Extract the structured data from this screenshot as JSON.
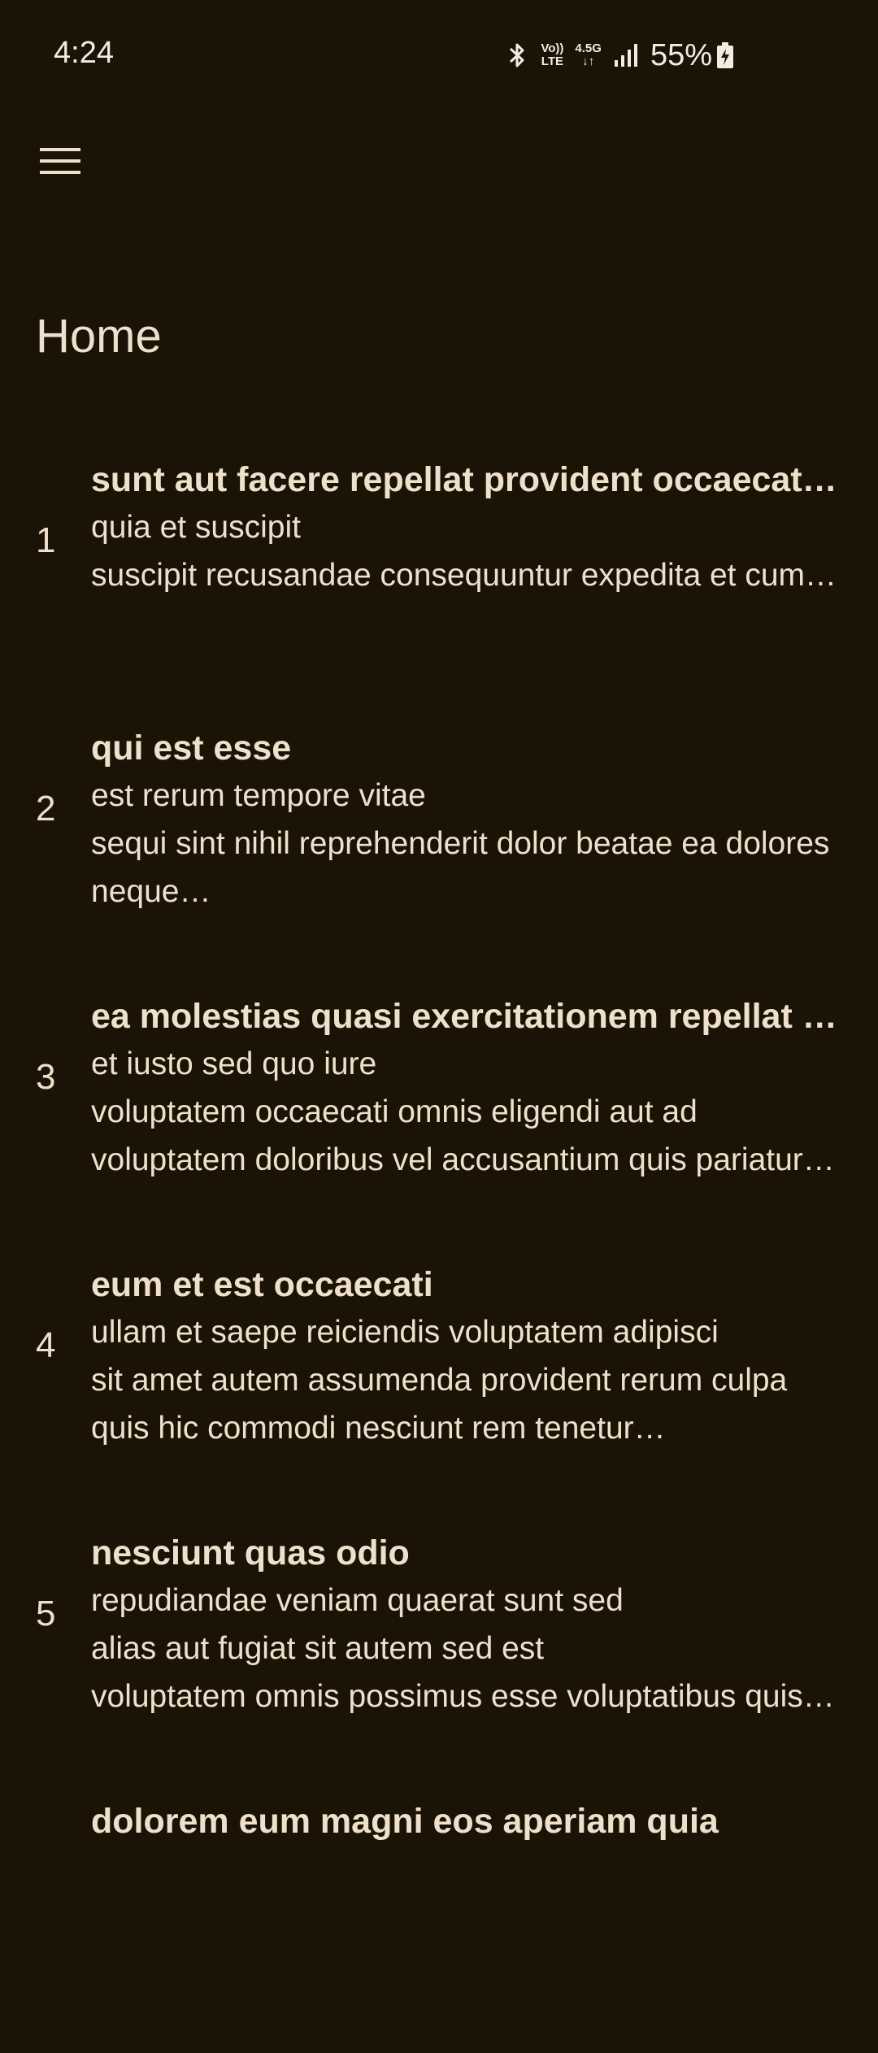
{
  "status_bar": {
    "time": "4:24",
    "volte_top": "Vo))",
    "volte_bottom": "LTE",
    "network_type": "4.5G",
    "battery_percent": "55%",
    "icons": [
      "bluetooth-icon",
      "volte-icon",
      "data-arrows-icon",
      "signal-icon",
      "battery-charging-icon"
    ]
  },
  "app_bar": {
    "menu_icon": "hamburger-menu-icon"
  },
  "page": {
    "title": "Home"
  },
  "posts": [
    {
      "index": "1",
      "title": "sunt aut facere repellat provident occaecati excepturi optio reprehenderit",
      "body": "quia et suscipit\nsuscipit recusandae consequuntur expedita et cum…"
    },
    {
      "index": "2",
      "title": "qui est esse",
      "body": "est rerum tempore vitae\nsequi sint nihil reprehenderit dolor beatae ea dolores neque…"
    },
    {
      "index": "3",
      "title": "ea molestias quasi exercitationem repellat qui ipsa sit aut",
      "body": "et iusto sed quo iure\nvoluptatem occaecati omnis eligendi aut ad\nvoluptatem doloribus vel accusantium quis pariatur…"
    },
    {
      "index": "4",
      "title": "eum et est occaecati",
      "body": "ullam et saepe reiciendis voluptatem adipisci\nsit amet autem assumenda provident rerum culpa\nquis hic commodi nesciunt rem tenetur doloremque…"
    },
    {
      "index": "5",
      "title": "nesciunt quas odio",
      "body": "repudiandae veniam quaerat sunt sed\nalias aut fugiat sit autem sed est\nvoluptatem omnis possimus esse voluptatibus quis…"
    },
    {
      "index": "",
      "title": "dolorem eum magni eos aperiam quia",
      "body": ""
    }
  ],
  "colors": {
    "background": "#1b1306",
    "text": "#efe0cc"
  }
}
